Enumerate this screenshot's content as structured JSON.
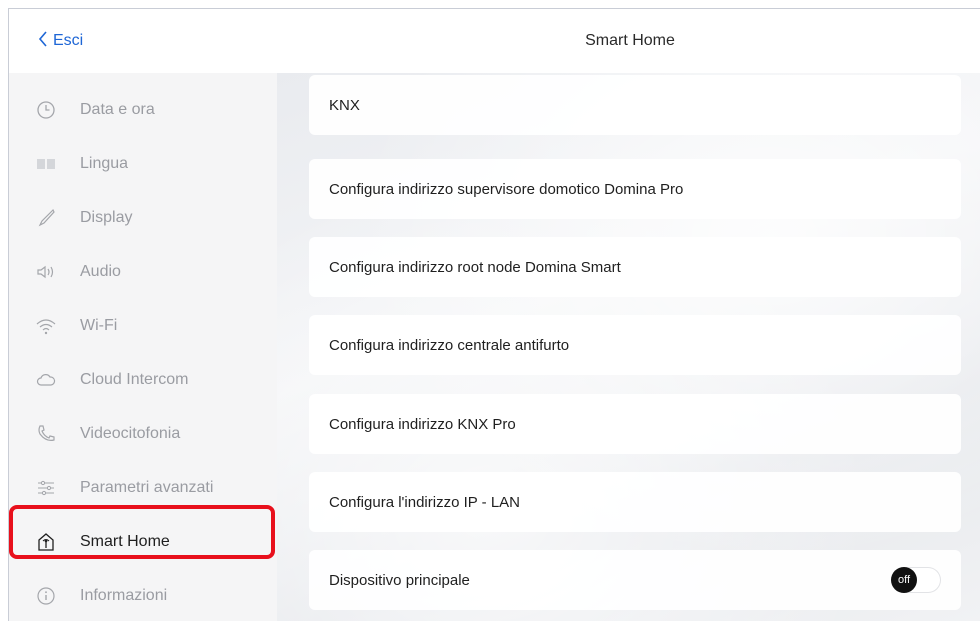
{
  "header": {
    "back_label": "Esci",
    "title": "Smart Home"
  },
  "sidebar": {
    "items": [
      {
        "label": "Data e ora",
        "icon": "clock-icon"
      },
      {
        "label": "Lingua",
        "icon": "book-icon"
      },
      {
        "label": "Display",
        "icon": "brush-icon"
      },
      {
        "label": "Audio",
        "icon": "speaker-icon"
      },
      {
        "label": "Wi-Fi",
        "icon": "wifi-icon"
      },
      {
        "label": "Cloud Intercom",
        "icon": "cloud-icon"
      },
      {
        "label": "Videocitofonia",
        "icon": "phone-icon"
      },
      {
        "label": "Parametri avanzati",
        "icon": "sliders-icon"
      },
      {
        "label": "Smart Home",
        "icon": "smart-home-icon",
        "active": true
      },
      {
        "label": "Informazioni",
        "icon": "info-icon"
      }
    ]
  },
  "main": {
    "rows": [
      {
        "label": "KNX"
      },
      {
        "label": "Configura indirizzo supervisore domotico Domina Pro"
      },
      {
        "label": "Configura indirizzo root node Domina Smart"
      },
      {
        "label": "Configura indirizzo centrale antifurto"
      },
      {
        "label": "Configura indirizzo KNX Pro"
      },
      {
        "label": "Configura l'indirizzo IP - LAN"
      },
      {
        "label": "Dispositivo principale",
        "toggle": "off"
      }
    ]
  },
  "colors": {
    "accent": "#1e66d6",
    "highlight": "#e8101c",
    "toggle_knob": "#111111"
  }
}
